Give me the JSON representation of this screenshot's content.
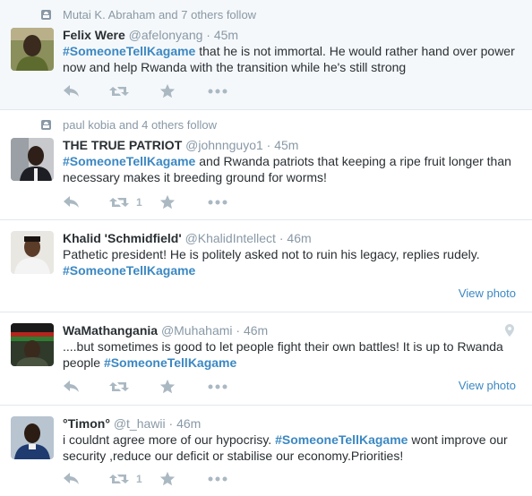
{
  "tweets": [
    {
      "context": "Mutai K. Abraham and 7 others follow",
      "name": "Felix Were",
      "handle": "@afelonyang",
      "sep": "·",
      "time": "45m",
      "hashtag": "#SomeoneTellKagame",
      "text": " that he is not immortal. He would rather hand over power now and help Rwanda with the transition while he's still strong",
      "retweets": ""
    },
    {
      "context": "paul kobia and 4 others follow",
      "name": "THE TRUE PATRIOT",
      "handle": "@johnnguyo1",
      "sep": "·",
      "time": "45m",
      "hashtag": "#SomeoneTellKagame",
      "text": " and Rwanda patriots that keeping a ripe fruit longer than necessary makes it breeding ground for worms!",
      "retweets": "1"
    },
    {
      "name": "Khalid 'Schmidfield'",
      "handle": "@KhalidIntellect",
      "sep": "·",
      "time": "46m",
      "text": "Pathetic president! He is politely asked not to ruin his legacy, replies rudely.",
      "hashtag": "#SomeoneTellKagame",
      "view_photo": "View photo"
    },
    {
      "name": "WaMathangania",
      "handle": "@Muhahami",
      "sep": "·",
      "time": "46m",
      "text": "....but sometimes is good to let people fight their own battles! It is up to Rwanda people ",
      "hashtag": "#SomeoneTellKagame",
      "view_photo": "View photo"
    },
    {
      "name": "°Timon°",
      "handle": "@t_hawii",
      "sep": "·",
      "time": "46m",
      "text_before": "i couldnt agree more of our hypocrisy. ",
      "hashtag": "#SomeoneTellKagame",
      "text_after": " wont improve our security ,reduce our deficit or stabilise our economy.Priorities!",
      "retweets": "1"
    }
  ],
  "icons": {
    "reply": "reply-icon",
    "retweet": "retweet-icon",
    "favorite": "star-icon",
    "more": "more-icon",
    "follow": "follow-context-icon",
    "geo": "location-pin-icon"
  },
  "colors": {
    "hashtag": "#3b88c3",
    "meta": "#8899a6",
    "action": "#aab8c2",
    "highlight_bg": "#f5f8fa",
    "divider": "#e1e8ed"
  }
}
